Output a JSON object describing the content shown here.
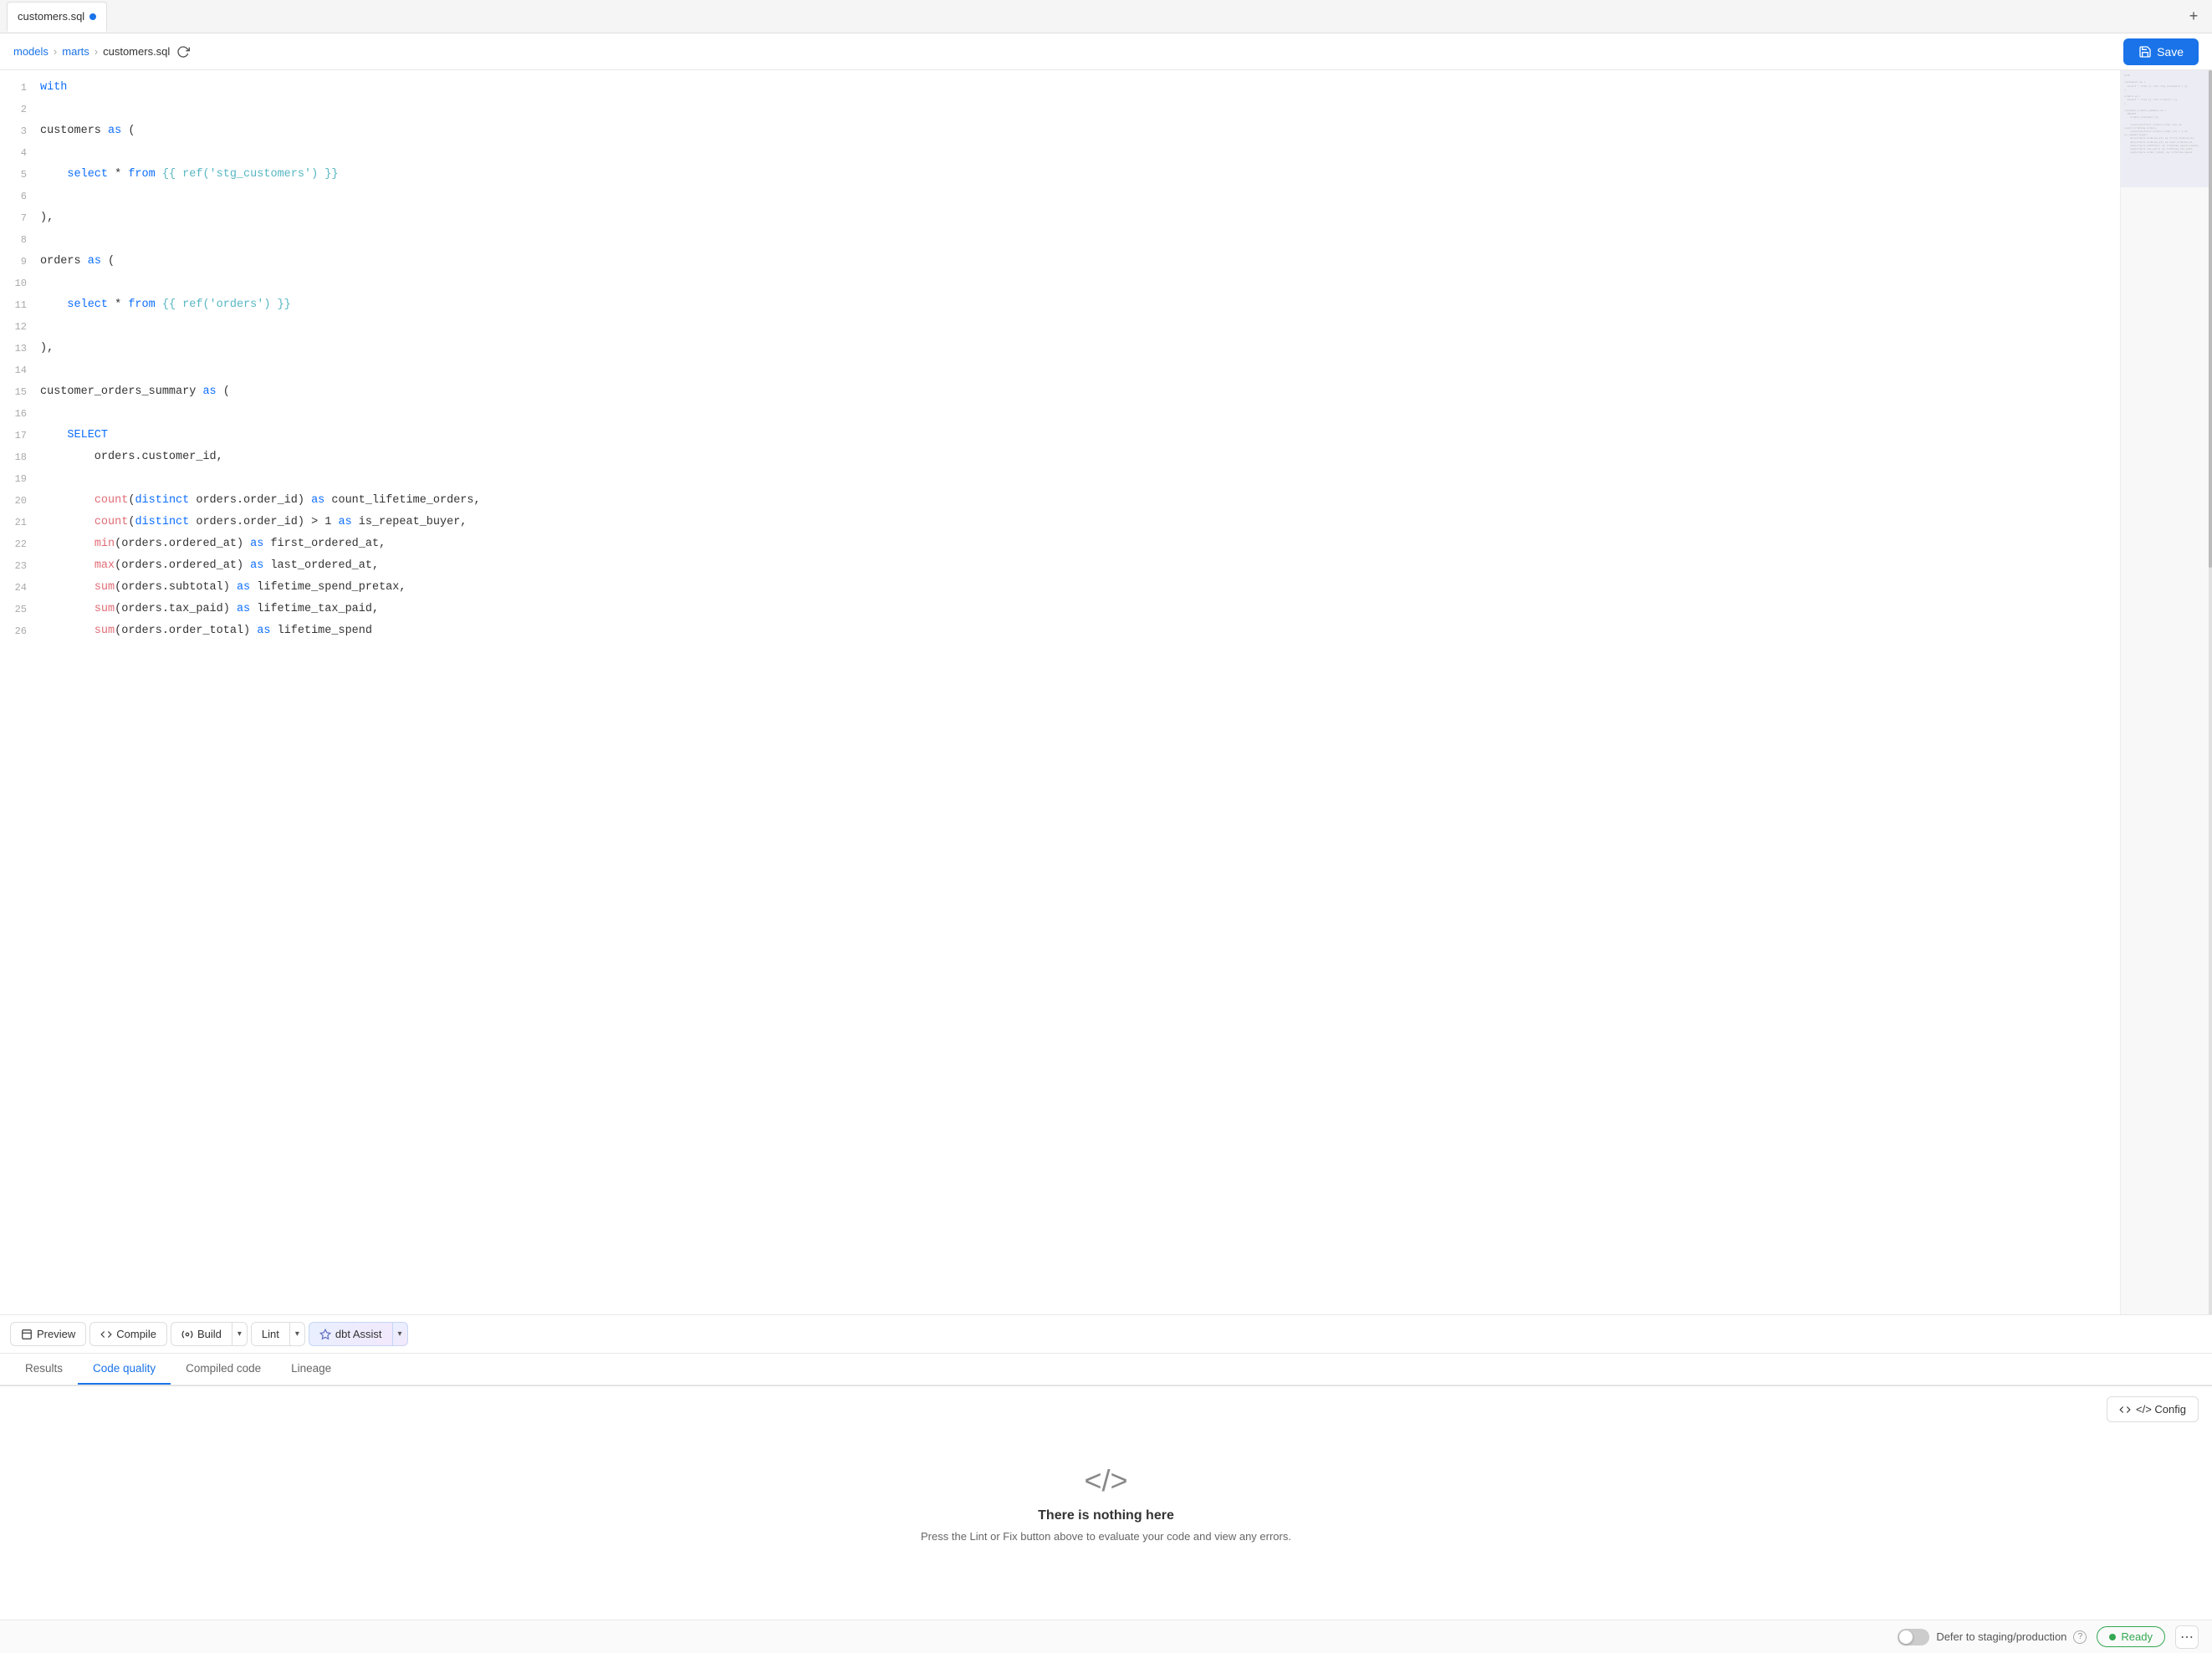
{
  "tab": {
    "filename": "customers.sql",
    "has_unsaved": true
  },
  "add_tab_label": "+",
  "breadcrumb": {
    "parts": [
      "models",
      "marts",
      "customers.sql"
    ]
  },
  "save_button": "Save",
  "code": {
    "lines": [
      {
        "num": 1,
        "tokens": [
          {
            "t": "kw",
            "v": "with"
          }
        ]
      },
      {
        "num": 2,
        "tokens": []
      },
      {
        "num": 3,
        "tokens": [
          {
            "t": "plain",
            "v": "customers "
          },
          {
            "t": "kw",
            "v": "as"
          },
          {
            "t": "plain",
            "v": " ("
          }
        ]
      },
      {
        "num": 4,
        "tokens": []
      },
      {
        "num": 5,
        "tokens": [
          {
            "t": "plain",
            "v": "    "
          },
          {
            "t": "kw",
            "v": "select"
          },
          {
            "t": "plain",
            "v": " * "
          },
          {
            "t": "kw",
            "v": "from"
          },
          {
            "t": "plain",
            "v": " "
          },
          {
            "t": "tpl",
            "v": "{{ ref('stg_customers') }}"
          }
        ]
      },
      {
        "num": 6,
        "tokens": []
      },
      {
        "num": 7,
        "tokens": [
          {
            "t": "plain",
            "v": "),"
          }
        ]
      },
      {
        "num": 8,
        "tokens": []
      },
      {
        "num": 9,
        "tokens": [
          {
            "t": "plain",
            "v": "orders "
          },
          {
            "t": "kw",
            "v": "as"
          },
          {
            "t": "plain",
            "v": " ("
          }
        ]
      },
      {
        "num": 10,
        "tokens": []
      },
      {
        "num": 11,
        "tokens": [
          {
            "t": "plain",
            "v": "    "
          },
          {
            "t": "kw",
            "v": "select"
          },
          {
            "t": "plain",
            "v": " * "
          },
          {
            "t": "kw",
            "v": "from"
          },
          {
            "t": "plain",
            "v": " "
          },
          {
            "t": "tpl",
            "v": "{{ ref('orders') }}"
          }
        ]
      },
      {
        "num": 12,
        "tokens": []
      },
      {
        "num": 13,
        "tokens": [
          {
            "t": "plain",
            "v": "),"
          }
        ]
      },
      {
        "num": 14,
        "tokens": []
      },
      {
        "num": 15,
        "tokens": [
          {
            "t": "plain",
            "v": "customer_orders_summary "
          },
          {
            "t": "kw",
            "v": "as"
          },
          {
            "t": "plain",
            "v": " ("
          }
        ]
      },
      {
        "num": 16,
        "tokens": []
      },
      {
        "num": 17,
        "tokens": [
          {
            "t": "plain",
            "v": "    "
          },
          {
            "t": "kw",
            "v": "SELECT"
          }
        ]
      },
      {
        "num": 18,
        "tokens": [
          {
            "t": "plain",
            "v": "        orders.customer_id,"
          }
        ]
      },
      {
        "num": 19,
        "tokens": []
      },
      {
        "num": 20,
        "tokens": [
          {
            "t": "plain",
            "v": "        "
          },
          {
            "t": "fn",
            "v": "count"
          },
          {
            "t": "plain",
            "v": "("
          },
          {
            "t": "kw",
            "v": "distinct"
          },
          {
            "t": "plain",
            "v": " orders.order_id) "
          },
          {
            "t": "kw",
            "v": "as"
          },
          {
            "t": "plain",
            "v": " count_lifetime_orders,"
          }
        ]
      },
      {
        "num": 21,
        "tokens": [
          {
            "t": "plain",
            "v": "        "
          },
          {
            "t": "fn",
            "v": "count"
          },
          {
            "t": "plain",
            "v": "("
          },
          {
            "t": "kw",
            "v": "distinct"
          },
          {
            "t": "plain",
            "v": " orders.order_id) > 1 "
          },
          {
            "t": "kw",
            "v": "as"
          },
          {
            "t": "plain",
            "v": " is_repeat_buyer,"
          }
        ]
      },
      {
        "num": 22,
        "tokens": [
          {
            "t": "plain",
            "v": "        "
          },
          {
            "t": "fn",
            "v": "min"
          },
          {
            "t": "plain",
            "v": "(orders.ordered_at) "
          },
          {
            "t": "kw",
            "v": "as"
          },
          {
            "t": "plain",
            "v": " first_ordered_at,"
          }
        ]
      },
      {
        "num": 23,
        "tokens": [
          {
            "t": "plain",
            "v": "        "
          },
          {
            "t": "fn",
            "v": "max"
          },
          {
            "t": "plain",
            "v": "(orders.ordered_at) "
          },
          {
            "t": "kw",
            "v": "as"
          },
          {
            "t": "plain",
            "v": " last_ordered_at,"
          }
        ]
      },
      {
        "num": 24,
        "tokens": [
          {
            "t": "plain",
            "v": "        "
          },
          {
            "t": "fn",
            "v": "sum"
          },
          {
            "t": "plain",
            "v": "(orders.subtotal) "
          },
          {
            "t": "kw",
            "v": "as"
          },
          {
            "t": "plain",
            "v": " lifetime_spend_pretax,"
          }
        ]
      },
      {
        "num": 25,
        "tokens": [
          {
            "t": "plain",
            "v": "        "
          },
          {
            "t": "fn",
            "v": "sum"
          },
          {
            "t": "plain",
            "v": "(orders.tax_paid) "
          },
          {
            "t": "kw",
            "v": "as"
          },
          {
            "t": "plain",
            "v": " lifetime_tax_paid,"
          }
        ]
      },
      {
        "num": 26,
        "tokens": [
          {
            "t": "plain",
            "v": "        "
          },
          {
            "t": "fn",
            "v": "sum"
          },
          {
            "t": "plain",
            "v": "(orders.order_total) "
          },
          {
            "t": "kw",
            "v": "as"
          },
          {
            "t": "plain",
            "v": " lifetime_spend"
          }
        ]
      }
    ]
  },
  "toolbar": {
    "preview": "Preview",
    "compile": "Compile",
    "build": "Build",
    "lint": "Lint",
    "dbt_assist": "dbt Assist"
  },
  "tabs": {
    "items": [
      "Results",
      "Code quality",
      "Compiled code",
      "Lineage"
    ],
    "active": "Code quality"
  },
  "bottom_panel": {
    "config_label": "</> Config",
    "empty_icon": "</>",
    "empty_title": "There is nothing here",
    "empty_desc": "Press the Lint or Fix button above to evaluate your code and view any errors."
  },
  "status_bar": {
    "cursor": "",
    "defer_label": "Defer to staging/production",
    "ready_label": "Ready",
    "has_info": true
  }
}
